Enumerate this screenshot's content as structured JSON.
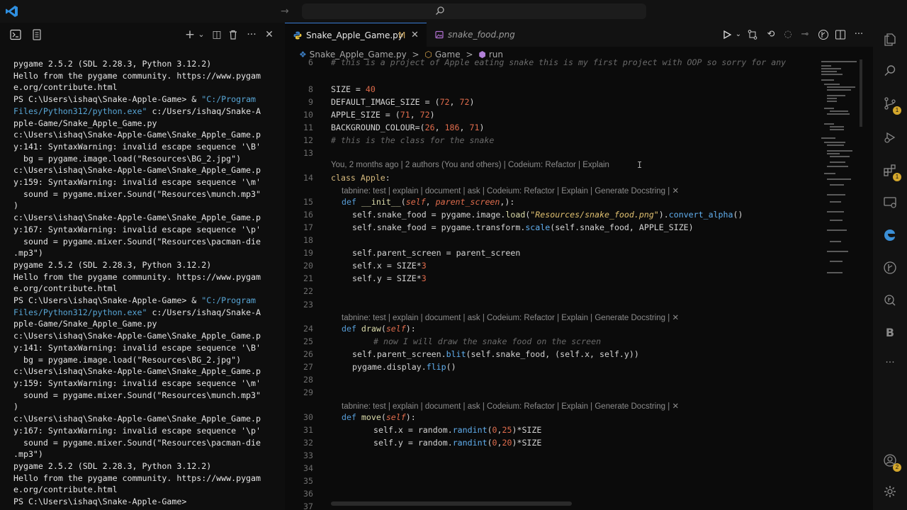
{
  "titlebar": {
    "nav_arrow": "→"
  },
  "panel": {
    "toolbar": {
      "add": "+",
      "chevron": "⌄",
      "split": "◫",
      "trash": "🗑",
      "more": "···",
      "close": "✕"
    },
    "terminal_lines": [
      "pygame 2.5.2 (SDL 2.28.3, Python 3.12.2)",
      "Hello from the pygame community. https://www.pygam",
      "e.org/contribute.html",
      "PS C:\\Users\\ishaq\\Snake-Apple-Game> & \"C:/Program",
      "Files/Python312/python.exe\" c:/Users/ishaq/Snake-A",
      "pple-Game/Snake_Apple_Game.py",
      "c:\\Users\\ishaq\\Snake-Apple-Game\\Snake_Apple_Game.p",
      "y:141: SyntaxWarning: invalid escape sequence '\\B'",
      "  bg = pygame.image.load(\"Resources\\BG_2.jpg\")",
      "c:\\Users\\ishaq\\Snake-Apple-Game\\Snake_Apple_Game.p",
      "y:159: SyntaxWarning: invalid escape sequence '\\m'",
      "  sound = pygame.mixer.Sound(\"Resources\\munch.mp3\"",
      ")",
      "c:\\Users\\ishaq\\Snake-Apple-Game\\Snake_Apple_Game.p",
      "y:167: SyntaxWarning: invalid escape sequence '\\p'",
      "  sound = pygame.mixer.Sound(\"Resources\\pacman-die",
      ".mp3\")",
      "pygame 2.5.2 (SDL 2.28.3, Python 3.12.2)",
      "Hello from the pygame community. https://www.pygam",
      "e.org/contribute.html",
      "PS C:\\Users\\ishaq\\Snake-Apple-Game> & \"C:/Program",
      "Files/Python312/python.exe\" c:/Users/ishaq/Snake-A",
      "pple-Game/Snake_Apple_Game.py",
      "c:\\Users\\ishaq\\Snake-Apple-Game\\Snake_Apple_Game.p",
      "y:141: SyntaxWarning: invalid escape sequence '\\B'",
      "  bg = pygame.image.load(\"Resources\\BG_2.jpg\")",
      "c:\\Users\\ishaq\\Snake-Apple-Game\\Snake_Apple_Game.p",
      "y:159: SyntaxWarning: invalid escape sequence '\\m'",
      "  sound = pygame.mixer.Sound(\"Resources\\munch.mp3\"",
      ")",
      "c:\\Users\\ishaq\\Snake-Apple-Game\\Snake_Apple_Game.p",
      "y:167: SyntaxWarning: invalid escape sequence '\\p'",
      "  sound = pygame.mixer.Sound(\"Resources\\pacman-die",
      ".mp3\")",
      "pygame 2.5.2 (SDL 2.28.3, Python 3.12.2)",
      "Hello from the pygame community. https://www.pygam",
      "e.org/contribute.html",
      "PS C:\\Users\\ishaq\\Snake-Apple-Game>"
    ]
  },
  "editor": {
    "tabs": [
      {
        "label": "Snake_Apple_Game.py",
        "modified": "M",
        "close": "✕"
      },
      {
        "label": "snake_food.png"
      }
    ],
    "breadcrumb": {
      "file": "Snake_Apple_Game.py",
      "sep": ">",
      "class": "Game",
      "method": "run"
    },
    "blame": "You, 2 months ago | 2 authors (You and others) | Codeium: Refactor | Explain",
    "tabnine_lens": "tabnine: test | explain | document | ask | Codeium: Refactor | Explain | Generate Docstring | ✕",
    "line_numbers": [
      "6",
      "8",
      "9",
      "10",
      "11",
      "12",
      "13",
      "14",
      "15",
      "16",
      "17",
      "18",
      "19",
      "20",
      "21",
      "22",
      "23",
      "24",
      "25",
      "26",
      "27",
      "28",
      "29",
      "30",
      "31",
      "32",
      "33",
      "34",
      "35",
      "36",
      "37"
    ],
    "code": {
      "l6": "# this is a project of Apple eating snake this is my first project with OOP so sorry for any",
      "l8a": "SIZE = ",
      "l8b": "40",
      "l9a": "DEFAULT_IMAGE_SIZE = (",
      "l9b": "72",
      "l9c": ", ",
      "l9d": "72",
      "l9e": ")",
      "l10a": "APPLE_SIZE = (",
      "l10b": "71",
      "l10c": ", ",
      "l10d": "72",
      "l10e": ")",
      "l11a": "BACKGROUND_COLOUR=(",
      "l11b": "26",
      "l11c": ", ",
      "l11d": "186",
      "l11e": ", ",
      "l11f": "71",
      "l11g": ")",
      "l12": "# this is the class for the snake",
      "l14a": "class ",
      "l14b": "Apple",
      "l14c": ":",
      "l15a": "def ",
      "l15b": "__init__",
      "l15c": "(",
      "l15d": "self",
      "l15e": ", ",
      "l15f": "parent_screen",
      "l15g": ",):",
      "l16a": "self.snake_food = pygame.image.",
      "l16b": "load",
      "l16c": "(",
      "l16d": "\"Resources/snake_food.png\"",
      "l16e": ").",
      "l16f": "convert_alpha",
      "l16g": "()",
      "l17a": "self.snake_food = pygame.transform.",
      "l17b": "scale",
      "l17c": "(self.snake_food, APPLE_SIZE)",
      "l19": "self.parent_screen = parent_screen",
      "l20a": "self.x = SIZE*",
      "l20b": "3",
      "l21a": "self.y = SIZE*",
      "l21b": "3",
      "l24a": "def ",
      "l24b": "draw",
      "l24c": "(",
      "l24d": "self",
      "l24e": "):",
      "l25": "# now I will draw the snake food on the screen",
      "l26a": "self.parent_screen.",
      "l26b": "blit",
      "l26c": "(self.snake_food, (self.x, self.y))",
      "l27a": "pygame.display.",
      "l27b": "flip",
      "l27c": "()",
      "l30a": "def ",
      "l30b": "move",
      "l30c": "(",
      "l30d": "self",
      "l30e": "):",
      "l31a": "self.x = random.",
      "l31b": "randint",
      "l31c": "(",
      "l31d": "0",
      "l31e": ",",
      "l31f": "25",
      "l31g": ")*SIZE",
      "l32a": "self.y = random.",
      "l32b": "randint",
      "l32c": "(",
      "l32d": "0",
      "l32e": ",",
      "l32f": "20",
      "l32g": ")*SIZE"
    }
  },
  "activity": {
    "badges": {
      "scm": "1",
      "extensions": "1",
      "accounts": "2"
    },
    "b_label": "B",
    "more": "···"
  },
  "colors": {
    "accent": "#3a7bd5",
    "badge": "#d4a72c",
    "path": "#58a6d6"
  }
}
